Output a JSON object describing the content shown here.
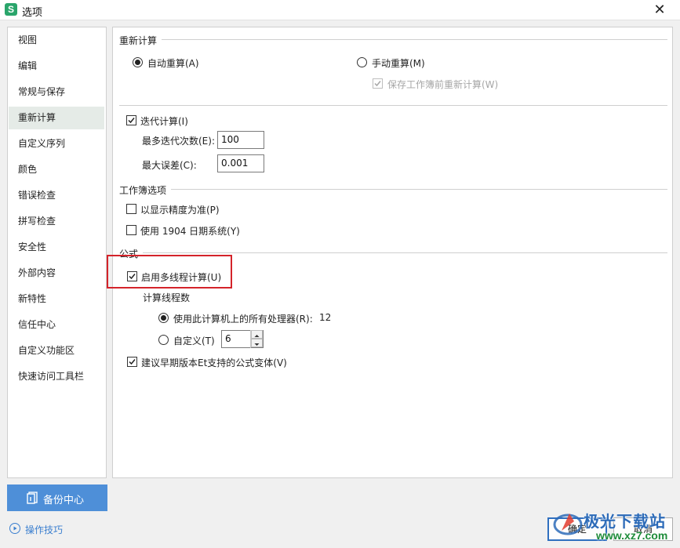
{
  "window": {
    "title": "选项",
    "app_logo": "S",
    "close": "✕"
  },
  "sidebar": {
    "items": [
      {
        "label": "视图"
      },
      {
        "label": "编辑"
      },
      {
        "label": "常规与保存"
      },
      {
        "label": "重新计算",
        "active": true
      },
      {
        "label": "自定义序列"
      },
      {
        "label": "颜色"
      },
      {
        "label": "错误检查"
      },
      {
        "label": "拼写检查"
      },
      {
        "label": "安全性"
      },
      {
        "label": "外部内容"
      },
      {
        "label": "新特性"
      },
      {
        "label": "信任中心"
      },
      {
        "label": "自定义功能区"
      },
      {
        "label": "快速访问工具栏"
      }
    ]
  },
  "recalc": {
    "section_title": "重新计算",
    "auto_label": "自动重算(A)",
    "auto_checked": true,
    "manual_label": "手动重算(M)",
    "manual_checked": false,
    "save_before_label": "保存工作簿前重新计算(W)",
    "save_before_checked": true,
    "save_before_disabled": true
  },
  "iteration": {
    "label": "迭代计算(I)",
    "checked": true,
    "max_iter_label": "最多迭代次数(E):",
    "max_iter_value": "100",
    "max_change_label": "最大误差(C):",
    "max_change_value": "0.001"
  },
  "workbook": {
    "section_title": "工作簿选项",
    "precision_label": "以显示精度为准(P)",
    "precision_checked": false,
    "date1904_label": "使用 1904 日期系统(Y)",
    "date1904_checked": false
  },
  "formula": {
    "section_title": "公式",
    "multithread_label": "启用多线程计算(U)",
    "multithread_checked": true,
    "threads_title": "计算线程数",
    "use_all_label": "使用此计算机上的所有处理器(R):",
    "use_all_value": "12",
    "use_all_checked": true,
    "custom_label": "自定义(T)",
    "custom_value": "6",
    "custom_checked": false,
    "legacy_label": "建议早期版本Et支持的公式变体(V)",
    "legacy_checked": true
  },
  "footer": {
    "backup_label": "备份中心",
    "tips_label": "操作技巧",
    "ok_label": "确定",
    "cancel_label": "取消"
  },
  "watermark": {
    "text": "极光下载站",
    "url": "www.xz7.com"
  },
  "colors": {
    "accent": "#4e8fd8",
    "highlight_border": "#d4232a",
    "active_nav": "#e5ebe7",
    "link": "#3b7fcf"
  }
}
